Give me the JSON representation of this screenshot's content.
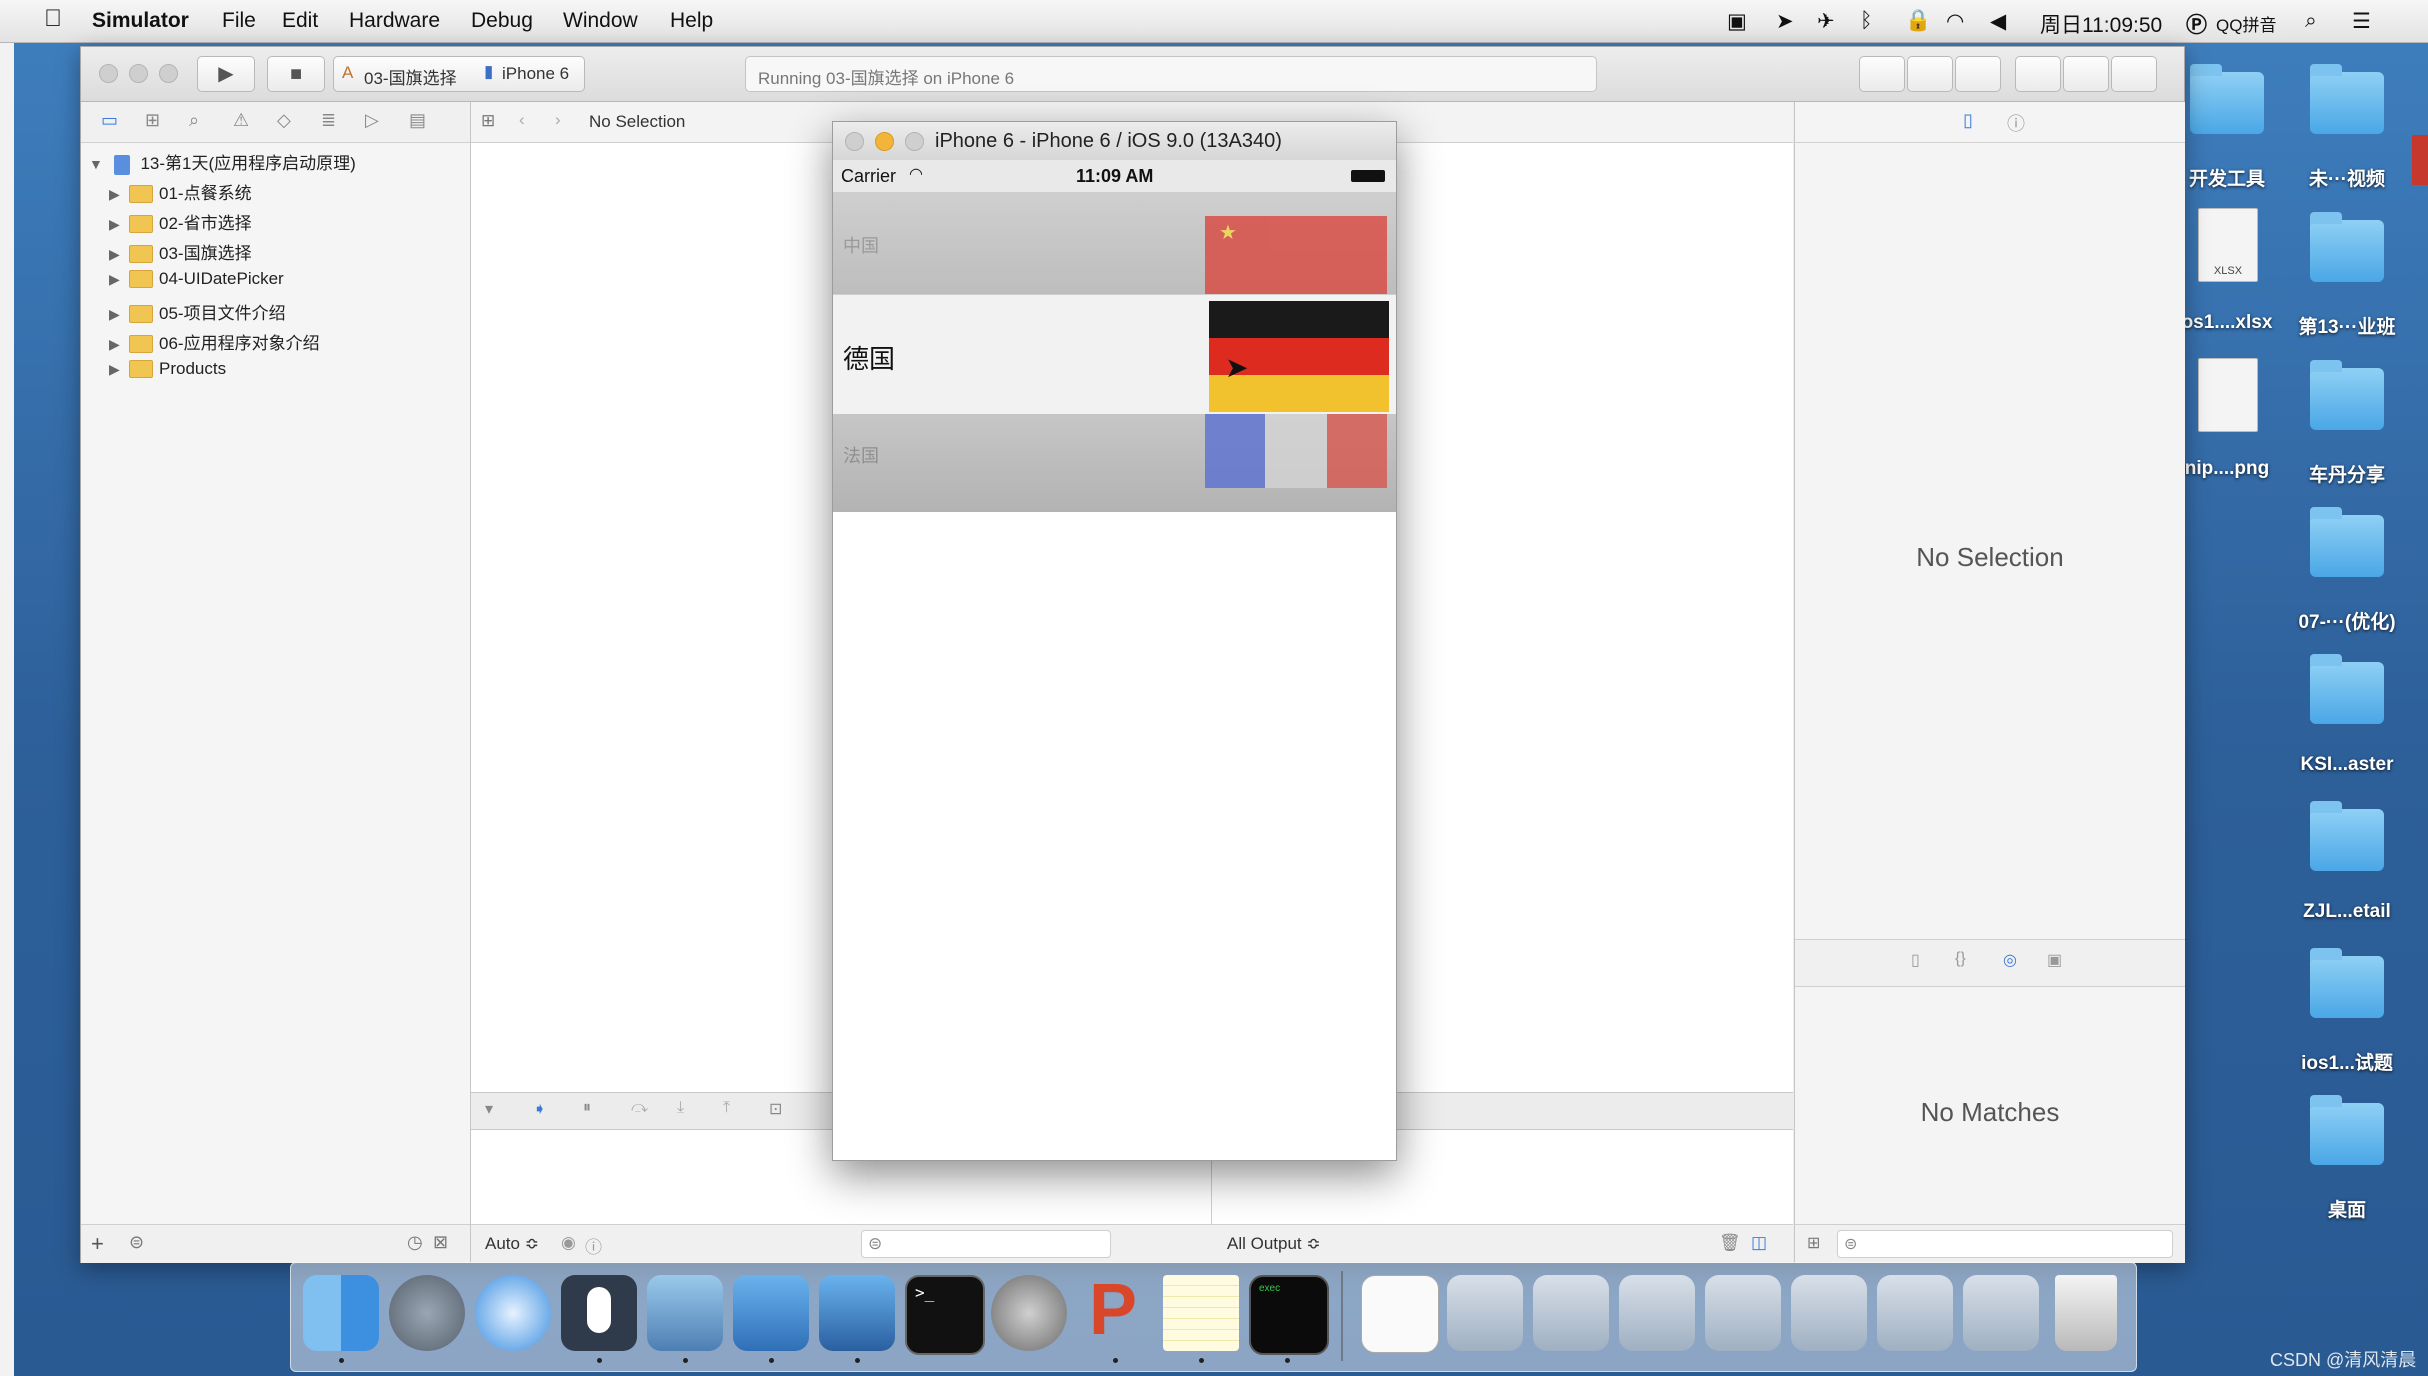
{
  "menubar": {
    "app": "Simulator",
    "items": [
      "File",
      "Edit",
      "Hardware",
      "Debug",
      "Window",
      "Help"
    ],
    "clock": "周日11:09:50",
    "input_method": "QQ拼音"
  },
  "xcode": {
    "scheme": "03-国旗选择",
    "device": "iPhone 6",
    "status": "Running 03-国旗选择 on iPhone 6",
    "jump_no_selection": "No Selection",
    "navigator": {
      "project": "13-第1天(应用程序启动原理)",
      "folders": [
        "01-点餐系统",
        "02-省市选择",
        "03-国旗选择",
        "04-UIDatePicker",
        "05-项目文件介绍",
        "06-应用程序对象介绍",
        "Products"
      ]
    },
    "console": {
      "auto_label": "Auto ≎",
      "output_label": "All Output ≎"
    },
    "inspector": {
      "no_selection": "No Selection",
      "no_matches": "No Matches"
    }
  },
  "simulator": {
    "title": "iPhone 6 - iPhone 6 / iOS 9.0 (13A340)",
    "carrier": "Carrier",
    "time": "11:09 AM",
    "rows": [
      {
        "label": "中国",
        "state": "faded"
      },
      {
        "label": "德国",
        "state": "selected"
      },
      {
        "label": "法国",
        "state": "faded"
      }
    ]
  },
  "desktop_icons": [
    {
      "label": "开发工具"
    },
    {
      "label": "未···视频"
    },
    {
      "label": "os1....xlsx"
    },
    {
      "label": "第13···业班"
    },
    {
      "label": "nip....png"
    },
    {
      "label": "车丹分享"
    },
    {
      "label": "07-···(优化)"
    },
    {
      "label": "KSI...aster"
    },
    {
      "label": "ZJL...etail"
    },
    {
      "label": "ios1...试题"
    },
    {
      "label": "桌面"
    }
  ],
  "file_badge": "XLSX",
  "dock": {
    "icons": [
      "finder-icon",
      "launchpad-icon",
      "safari-icon",
      "mouse-icon",
      "photo-slideshow-icon",
      "xcode-icon",
      "instruments-icon",
      "terminal-icon",
      "system-preferences-icon",
      "powerpoint-icon",
      "notes-icon",
      "exec-icon",
      "preview-icon",
      "window-icon-1",
      "window-icon-2",
      "window-icon-3",
      "window-icon-4",
      "window-icon-5",
      "window-icon-6",
      "window-icon-7",
      "trash-icon"
    ]
  },
  "watermark": "CSDN @清风清晨",
  "colors": {
    "de_black": "#1a1a1a",
    "de_red": "#dd2c1f",
    "de_gold": "#f2c12e",
    "fr_blue": "#5a6fd1",
    "fr_red": "#d8564f",
    "cn_red": "#d9473f"
  }
}
